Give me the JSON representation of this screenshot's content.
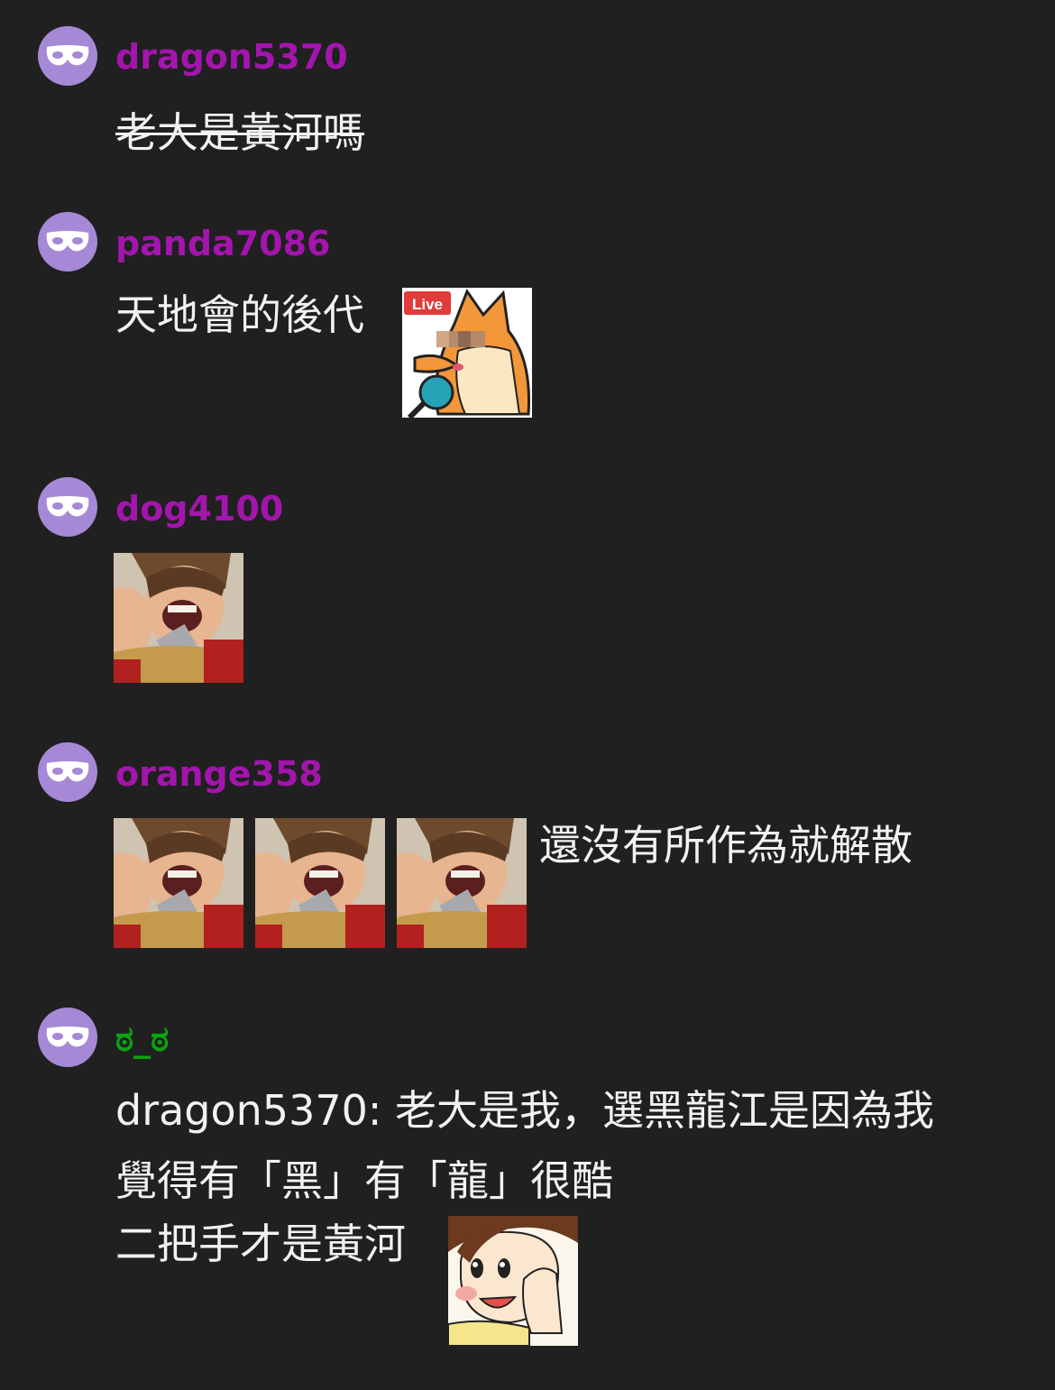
{
  "colors": {
    "background": "#202020",
    "avatar": "#a689d6",
    "username_default": "#a315ad",
    "username_green": "#0aa40e",
    "message_text": "#f2f2f2"
  },
  "messages": [
    {
      "username": "dragon5370",
      "text": "老大是黃河嗎",
      "strikethrough": true,
      "stickers": []
    },
    {
      "username": "panda7086",
      "text": "天地會的後代",
      "stickers": [
        "fox-live-microphone-sticker"
      ]
    },
    {
      "username": "dog4100",
      "text": "",
      "stickers": [
        "laughing-man-sticker"
      ]
    },
    {
      "username": "orange358",
      "text": "還沒有所作為就解散",
      "stickers": [
        "laughing-man-sticker",
        "laughing-man-sticker",
        "laughing-man-sticker"
      ]
    },
    {
      "username": "ಠ_ಠ",
      "username_color": "#0aa40e",
      "lines": [
        "dragon5370: 老大是我，選黑龍江是因為我",
        "覺得有「黑」有「龍」很酷",
        "二把手才是黃河"
      ],
      "stickers": [
        "cartoon-girl-whisper-sticker"
      ]
    }
  ],
  "sticker_badge": "Live"
}
